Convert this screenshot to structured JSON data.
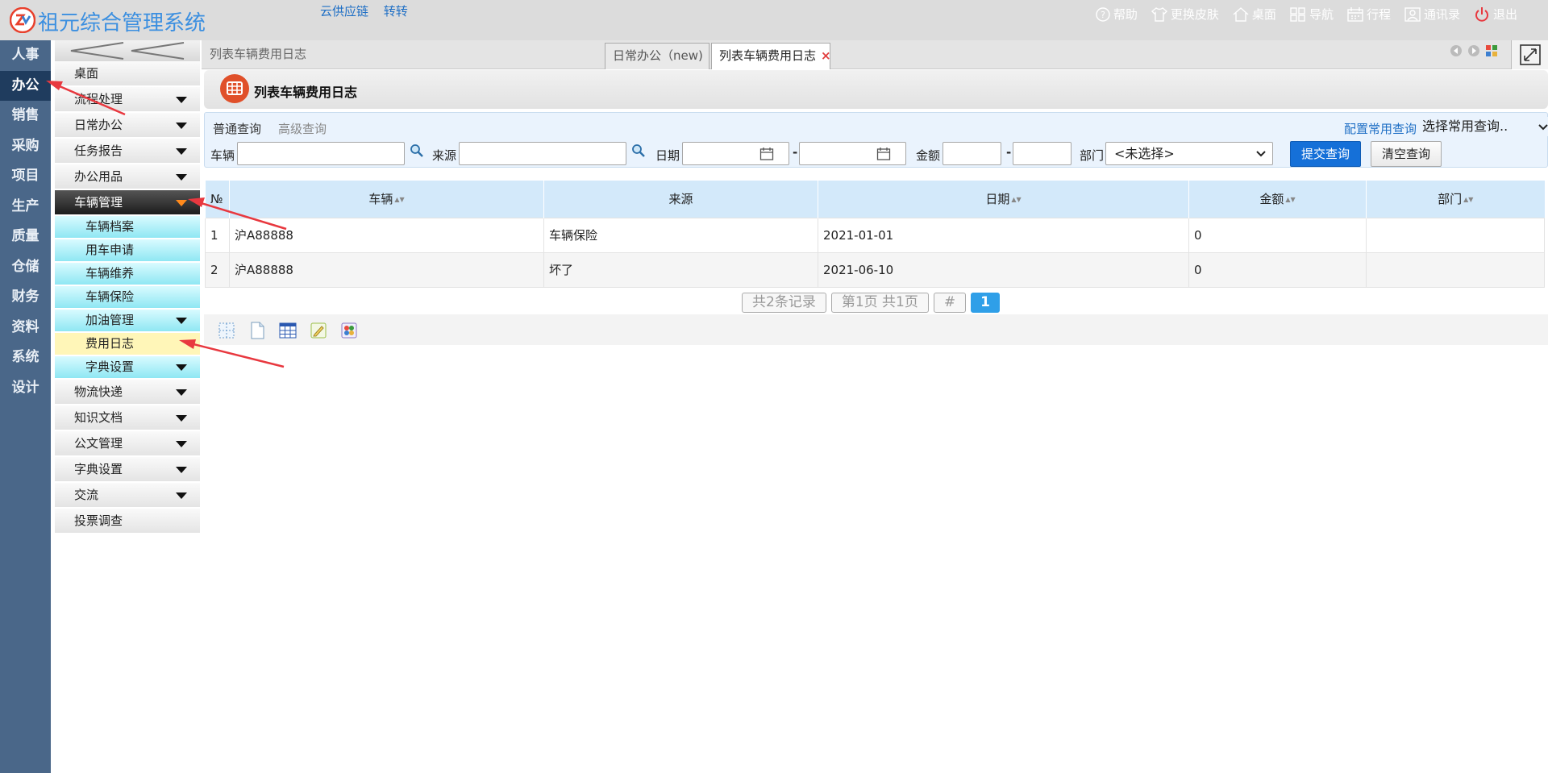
{
  "app": {
    "title": "祖元综合管理系统"
  },
  "top_links": [
    "云供应链",
    "转转"
  ],
  "toolbar": [
    {
      "label": "帮助",
      "icon": "help-icon"
    },
    {
      "label": "更换皮肤",
      "icon": "shirt-icon"
    },
    {
      "label": "桌面",
      "icon": "home-icon"
    },
    {
      "label": "导航",
      "icon": "grid-icon"
    },
    {
      "label": "行程",
      "icon": "calendar-icon"
    },
    {
      "label": "通讯录",
      "icon": "contact-icon"
    },
    {
      "label": "退出",
      "icon": "power-icon"
    }
  ],
  "left_nav": [
    "人事",
    "办公",
    "销售",
    "采购",
    "项目",
    "生产",
    "质量",
    "仓储",
    "财务",
    "资料",
    "系统",
    "设计"
  ],
  "left_nav_active": "办公",
  "sub_menu": {
    "items": [
      {
        "label": "桌面"
      },
      {
        "label": "流程处理"
      },
      {
        "label": "日常办公"
      },
      {
        "label": "任务报告"
      },
      {
        "label": "办公用品"
      },
      {
        "label": "车辆管理"
      },
      {
        "label": "车辆档案"
      },
      {
        "label": "用车申请"
      },
      {
        "label": "车辆维养"
      },
      {
        "label": "车辆保险"
      },
      {
        "label": "加油管理"
      },
      {
        "label": "费用日志"
      },
      {
        "label": "字典设置"
      },
      {
        "label": "物流快递"
      },
      {
        "label": "知识文档"
      },
      {
        "label": "公文管理"
      },
      {
        "label": "字典设置"
      },
      {
        "label": "交流"
      },
      {
        "label": "投票调查"
      }
    ]
  },
  "breadcrumb": "列表车辆费用日志",
  "tabs": [
    {
      "label": "日常办公（new)",
      "active": false
    },
    {
      "label": "列表车辆费用日志",
      "active": true,
      "close": "×"
    }
  ],
  "page_title": "列表车辆费用日志",
  "query": {
    "tabs": [
      "普通查询",
      "高级查询"
    ],
    "config_link": "配置常用查询",
    "saved_select": "选择常用查询..",
    "labels": {
      "vehicle": "车辆",
      "source": "来源",
      "date": "日期",
      "amount": "金额",
      "dept": "部门"
    },
    "dash": "-",
    "dept_value": "<未选择>",
    "submit": "提交查询",
    "clear": "清空查询"
  },
  "grid": {
    "columns": [
      "№",
      "车辆",
      "来源",
      "日期",
      "金额",
      "部门"
    ],
    "rows": [
      [
        "1",
        "沪A88888",
        "车辆保险",
        "2021-01-01",
        "0",
        ""
      ],
      [
        "2",
        "沪A88888",
        "坏了",
        "2021-06-10",
        "0",
        ""
      ]
    ]
  },
  "pager": {
    "total": "共2条记录",
    "page_info": "第1页 共1页",
    "hash": "#",
    "current": "1"
  },
  "colors": {
    "accent": "#2f9fe8",
    "nav": "#4a6789",
    "nav_active": "#1f3c5e",
    "arrow": "#e8383f"
  }
}
